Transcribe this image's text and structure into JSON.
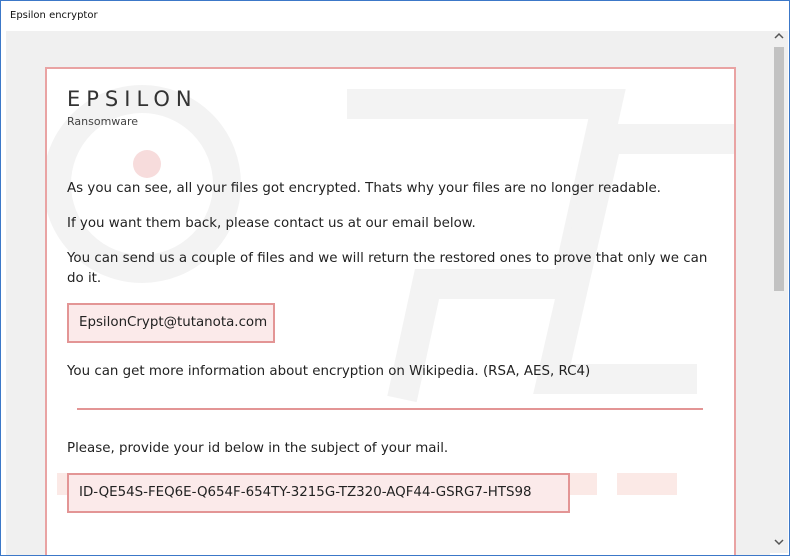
{
  "window": {
    "title": "Epsilon encryptor"
  },
  "note": {
    "brand_title": "EPSILON",
    "brand_subtitle": "Ransomware",
    "paragraph_1": "As you can see, all your files got encrypted. Thats why your files are no longer readable.",
    "paragraph_2": "If you want them back, please contact us at our email below.",
    "paragraph_3": "You can send us a couple of files and we will return the restored ones to prove that only we can do it.",
    "email": "EpsilonCrypt@tutanota.com",
    "paragraph_4": "You can get more information about encryption on Wikipedia. (RSA, AES, RC4)",
    "paragraph_5": "Please, provide your id below in the subject of your mail.",
    "victim_id": "ID-QE54S-FEQ6E-Q654F-654TY-3215G-TZ320-AQF44-GSRG7-HTS98"
  },
  "colors": {
    "accent_border": "#e39595",
    "accent_fill": "#fbeaea",
    "window_border": "#3c78c8"
  },
  "icons": {
    "scroll_up": "chevron-up-icon",
    "scroll_down": "chevron-down-icon"
  }
}
